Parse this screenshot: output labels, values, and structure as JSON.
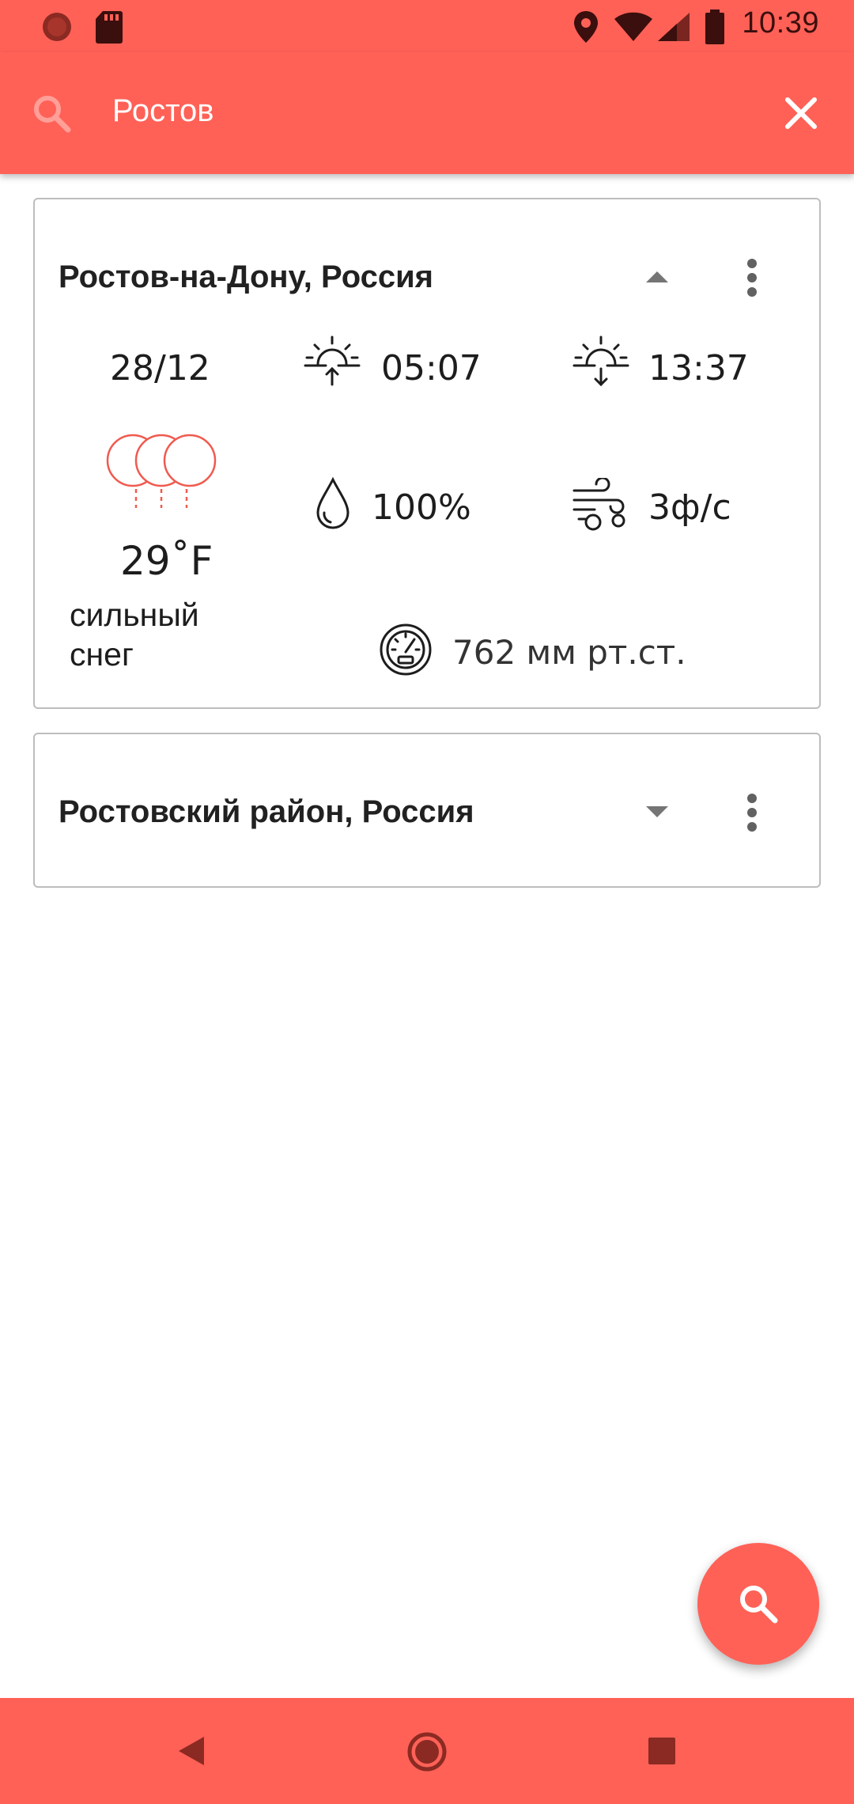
{
  "status_bar": {
    "time": "10:39",
    "icons": [
      "notification-dot-icon",
      "sd-card-icon",
      "location-icon",
      "wifi-icon",
      "signal-icon",
      "battery-icon"
    ]
  },
  "search": {
    "query": "Ростов",
    "icons": [
      "search-icon",
      "close-icon"
    ]
  },
  "results": [
    {
      "title": "Ростов-на-Дону, Россия",
      "expanded": true,
      "date": "28/12",
      "sunrise": "05:07",
      "sunset": "13:37",
      "temperature": "29˚F",
      "condition": "сильный снег",
      "humidity": "100%",
      "wind": "3ф/с",
      "pressure": "762 мм рт.ст."
    },
    {
      "title": "Ростовский район, Россия",
      "expanded": false
    }
  ],
  "colors": {
    "accent": "#ff6157",
    "card_border": "#bdbdbd",
    "text": "#212121"
  }
}
